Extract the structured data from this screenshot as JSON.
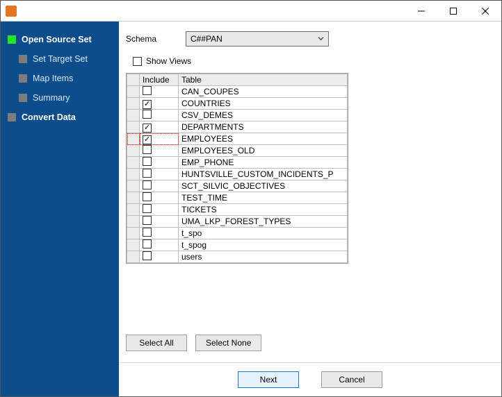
{
  "titlebar": {
    "title": ""
  },
  "sidebar": {
    "items": [
      {
        "label": "Open Source Set",
        "active": true,
        "child": false
      },
      {
        "label": "Set Target Set",
        "active": false,
        "child": true
      },
      {
        "label": "Map Items",
        "active": false,
        "child": true
      },
      {
        "label": "Summary",
        "active": false,
        "child": true
      },
      {
        "label": "Convert Data",
        "active": false,
        "child": false
      }
    ]
  },
  "form": {
    "schema_label": "Schema",
    "schema_selected": "C##PAN",
    "show_views_label": "Show Views",
    "show_views_checked": false
  },
  "grid": {
    "headers": {
      "include": "Include",
      "table": "Table"
    },
    "rows": [
      {
        "included": false,
        "name": "CAN_COUPES",
        "focused": false
      },
      {
        "included": true,
        "name": "COUNTRIES",
        "focused": false
      },
      {
        "included": false,
        "name": "CSV_DEMES",
        "focused": false
      },
      {
        "included": true,
        "name": "DEPARTMENTS",
        "focused": false
      },
      {
        "included": true,
        "name": "EMPLOYEES",
        "focused": true
      },
      {
        "included": false,
        "name": "EMPLOYEES_OLD",
        "focused": false
      },
      {
        "included": false,
        "name": "EMP_PHONE",
        "focused": false
      },
      {
        "included": false,
        "name": "HUNTSVILLE_CUSTOM_INCIDENTS_P",
        "focused": false
      },
      {
        "included": false,
        "name": "SCT_SILVIC_OBJECTIVES",
        "focused": false
      },
      {
        "included": false,
        "name": "TEST_TIME",
        "focused": false
      },
      {
        "included": false,
        "name": "TICKETS",
        "focused": false
      },
      {
        "included": false,
        "name": "UMA_LKP_FOREST_TYPES",
        "focused": false
      },
      {
        "included": false,
        "name": "t_spo",
        "focused": false
      },
      {
        "included": false,
        "name": "t_spog",
        "focused": false
      },
      {
        "included": false,
        "name": "users",
        "focused": false
      }
    ]
  },
  "buttons": {
    "select_all": "Select All",
    "select_none": "Select None",
    "next": "Next",
    "cancel": "Cancel"
  }
}
